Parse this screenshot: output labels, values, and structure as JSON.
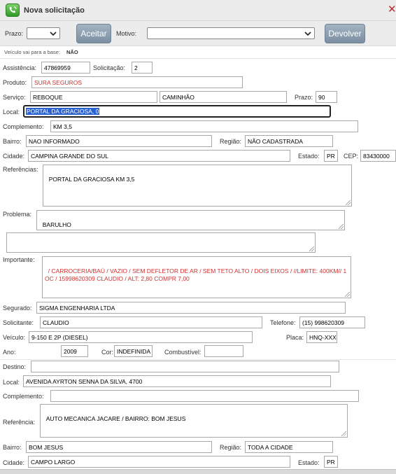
{
  "window": {
    "title": "Nova solicitação",
    "icon": "phone-refresh-icon",
    "close": "✕"
  },
  "toolbar": {
    "prazo_label": "Prazo:",
    "aceitar": "Aceitar",
    "motivo_label": "Motivo:",
    "devolver": "Devolver"
  },
  "base_info": {
    "label": "Veículo vai para a base:",
    "value": "NÃO"
  },
  "form": {
    "assistencia_label": "Assistência:",
    "assistencia": "47869959",
    "solicitacao_label": "Solicitação:",
    "solicitacao": "2",
    "produto_label": "Produto:",
    "produto": "SURA SEGUROS",
    "servico_label": "Serviço:",
    "servico": "REBOQUE",
    "servico2": "CAMINHÃO",
    "prazo_label": "Prazo:",
    "prazo": "90",
    "local_label": "Local:",
    "local": "PORTAL DA GRACIOSA, 0",
    "complemento_label": "Complemento:",
    "complemento": "KM 3,5",
    "bairro_label": "Bairro:",
    "bairro": "NAO INFORMADO",
    "regiao_label": "Região:",
    "regiao": "NÃO CADASTRADA",
    "cidade_label": "Cidade:",
    "cidade": "CAMPINA GRANDE DO SUL",
    "estado_label": "Estado:",
    "estado": "PR",
    "cep_label": "CEP:",
    "cep": "83430000",
    "referencias_label": "Referências:",
    "referencias": "PORTAL DA GRACIOSA KM 3,5",
    "problema_label": "Problema:",
    "problema": "BARULHO",
    "problema2": "",
    "importante_label": "Importante:",
    "importante": "/ CARROCERIA/BAÚ / VAZIO / SEM DEFLETOR DE AR / SEM TETO ALTO / DOIS EIXOS / //LIMITE: 400KM// 1 OC / 15998620309 CLAUDIO / ALT: 2,80 COMPR 7,00",
    "segurado_label": "Segurado:",
    "segurado": "SIGMA ENGENHARIA LTDA",
    "solicitante_label": "Solicitante:",
    "solicitante": "CLAUDIO",
    "telefone_label": "Telefone:",
    "telefone": "(15) 998620309",
    "veiculo_label": "Veículo:",
    "veiculo": "9-150 E 2P (DIESEL)",
    "placa_label": "Placa:",
    "placa": "HNQ-XXXX",
    "ano_label": "Ano:",
    "ano": "2009",
    "cor_label": "Cor:",
    "cor": "INDEFINIDA",
    "combustivel_label": "Combustível:",
    "combustivel": ""
  },
  "destino": {
    "destino_label": "Destino:",
    "destino": "",
    "local_label": "Local:",
    "local": "AVENIDA AYRTON SENNA DA SILVA, 4700",
    "complemento_label": "Complemento:",
    "complemento": "",
    "referencia_label": "Referência:",
    "referencia": "AUTO MECANICA JACARE / BAIRRO: BOM JESUS",
    "bairro_label": "Bairro:",
    "bairro": "BOM JESUS",
    "regiao_label": "Região:",
    "regiao": "TODA A CIDADE",
    "cidade_label": "Cidade:",
    "cidade": "CAMPO LARGO",
    "estado_label": "Estado:",
    "estado": "PR"
  },
  "colors": {
    "accent_red": "#d32f2f",
    "button": "#8a9caf",
    "close": "#c62828"
  }
}
